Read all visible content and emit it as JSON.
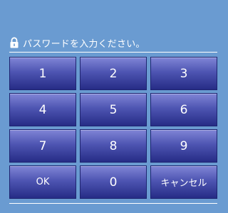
{
  "prompt": {
    "icon": "lock-icon",
    "text": "パスワードを入力ください。"
  },
  "keypad": {
    "keys": [
      "1",
      "2",
      "3",
      "4",
      "5",
      "6",
      "7",
      "8",
      "9",
      "OK",
      "0",
      "キャンセル"
    ]
  },
  "colors": {
    "background": "#6a9bd1",
    "key_top": "#8085d6",
    "key_bottom": "#262c86",
    "text": "#ffffff"
  }
}
